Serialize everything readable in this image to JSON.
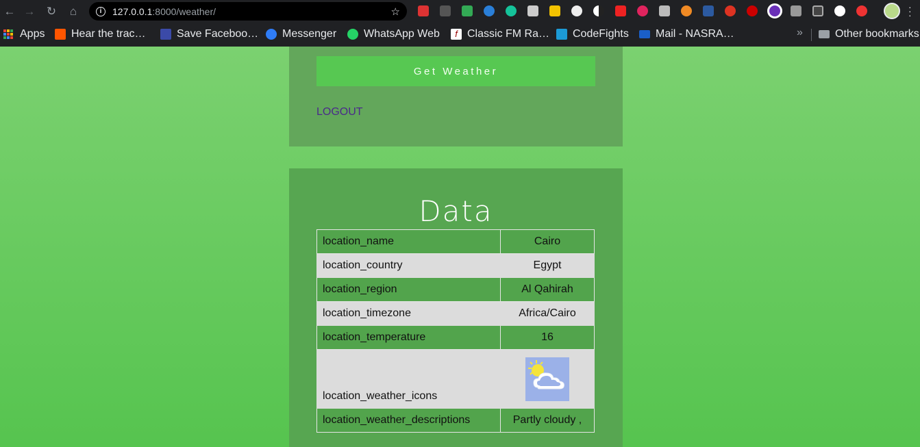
{
  "browser": {
    "url_host": "127.0.0.1",
    "url_path": ":8000/weather/",
    "bookmarks": [
      {
        "label": "Apps",
        "icon": "apps-grid-icon"
      },
      {
        "label": "Hear the trac…",
        "icon": "soundcloud-icon"
      },
      {
        "label": "Save Faceboo…",
        "icon": "savefrom-icon"
      },
      {
        "label": "Messenger",
        "icon": "messenger-icon"
      },
      {
        "label": "WhatsApp Web",
        "icon": "whatsapp-icon"
      },
      {
        "label": "Classic FM Ra…",
        "icon": "classicfm-icon"
      },
      {
        "label": "CodeFights",
        "icon": "codefights-icon"
      },
      {
        "label": "Mail - NASRA…",
        "icon": "mail-icon"
      }
    ],
    "overflow": "»",
    "other_bookmarks": "Other bookmarks"
  },
  "actions": {
    "get_weather": "Get Weather",
    "logout": "LOGOUT"
  },
  "data_section": {
    "title": "Data",
    "rows": [
      {
        "key": "location_name",
        "value": "Cairo"
      },
      {
        "key": "location_country",
        "value": "Egypt"
      },
      {
        "key": "location_region",
        "value": "Al Qahirah"
      },
      {
        "key": "location_timezone",
        "value": "Africa/Cairo"
      },
      {
        "key": "location_temperature",
        "value": "16"
      },
      {
        "key": "location_weather_icons",
        "value": "partly-cloudy-icon"
      },
      {
        "key": "location_weather_descriptions",
        "value": "Partly cloudy ,"
      }
    ]
  },
  "colors": {
    "page_bg_top": "#7bd170",
    "page_bg_bottom": "#56c44f",
    "button_bg": "#57c852",
    "logout_link": "#4a2a8a"
  }
}
